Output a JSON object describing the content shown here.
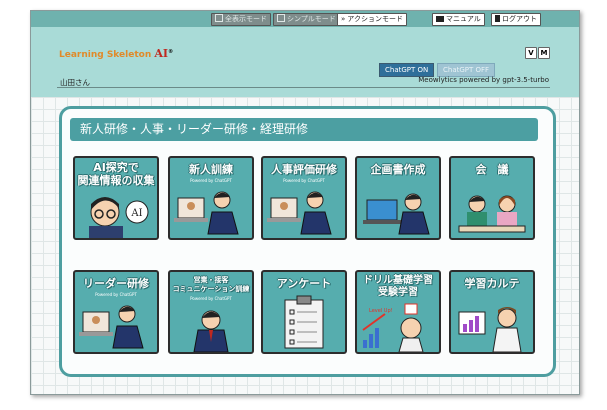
{
  "topbar": {
    "modes": [
      {
        "label": "全表示モード",
        "icon": "grid-icon"
      },
      {
        "label": "シンプルモード",
        "icon": "grid-icon"
      },
      {
        "label": "アクションモード",
        "icon": "double-chevron-icon"
      }
    ],
    "manual_label": "マニュアル",
    "logout_label": "ログアウト"
  },
  "header": {
    "logo_text": "Learning Skeleton",
    "logo_ai": "AI",
    "logo_mark": "®",
    "v_label": "V",
    "m_label": "M",
    "gpt_on_label": "ChatGPT ON",
    "gpt_off_label": "ChatGPT OFF",
    "user_label": "山田さん",
    "powered_by": "Meowlytics powered by gpt-3.5-turbo"
  },
  "section": {
    "title": "新人研修・人事・リーダー研修・経理研修"
  },
  "cards": [
    {
      "label1": "AI探究で",
      "label2": "関連情報の収集",
      "sub": ""
    },
    {
      "label1": "新人訓練",
      "label2": "",
      "sub": "Powered by ChatGPT"
    },
    {
      "label1": "人事評価研修",
      "label2": "",
      "sub": "Powered by ChatGPT"
    },
    {
      "label1": "企画書作成",
      "label2": "",
      "sub": ""
    },
    {
      "label1": "会　議",
      "label2": "",
      "sub": ""
    },
    {
      "label1": "リーダー研修",
      "label2": "",
      "sub": "Powered by ChatGPT"
    },
    {
      "label1": "営業・接客",
      "label2": "コミュニケーション訓練",
      "sub": "Powered by ChatGPT"
    },
    {
      "label1": "アンケート",
      "label2": "",
      "sub": ""
    },
    {
      "label1": "ドリル基礎学習",
      "label2": "受験学習",
      "sub": ""
    },
    {
      "label1": "学習カルテ",
      "label2": "",
      "sub": ""
    }
  ],
  "illustrations": {
    "ai_badge": "AI",
    "levelup_text": "Level Up!"
  },
  "colors": {
    "topbar": "#6fb2ae",
    "header": "#a9dbd7",
    "accent": "#4c9fa2",
    "card": "#56adae",
    "gpt_on": "#2f6f9a",
    "gpt_off": "#9fc4d3"
  }
}
